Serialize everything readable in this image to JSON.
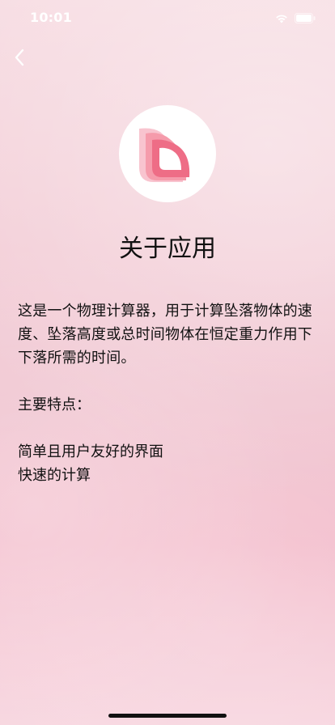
{
  "status_bar": {
    "time": "10:01",
    "icons": [
      "wifi-icon",
      "battery-icon"
    ]
  },
  "nav": {
    "back_icon": "chevron-left-icon"
  },
  "logo": {
    "icon": "app-logo",
    "colors": {
      "front": "#ee6d86",
      "mid": "#f59bab",
      "back": "#f8c4cf"
    }
  },
  "page": {
    "title": "关于应用"
  },
  "about": {
    "description": "这是一个物理计算器，用于计算坠落物体的速度、坠落高度或总时间物体在恒定重力作用下下落所需的时间。",
    "features_heading": "主要特点：",
    "features": [
      "简单且用户友好的界面",
      "快速的计算"
    ]
  },
  "colors": {
    "background_top": "#f7dde3",
    "background_bottom": "#f3bccb",
    "text": "#111111"
  }
}
